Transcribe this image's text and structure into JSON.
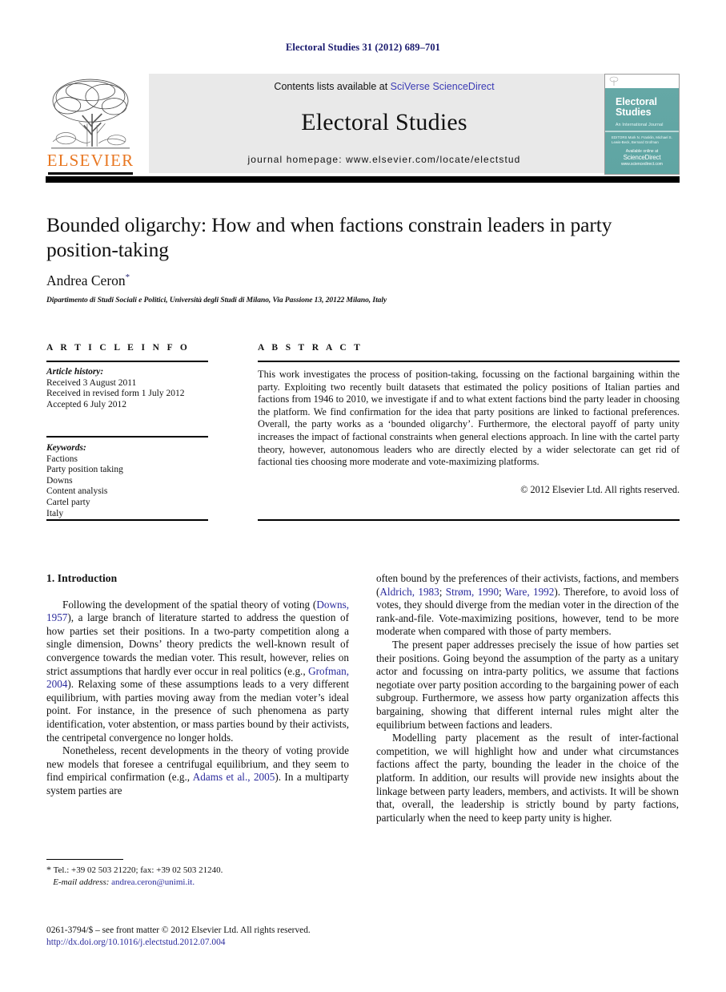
{
  "running_head": "Electoral Studies 31 (2012) 689–701",
  "header": {
    "elsevier_wordmark": "ELSEVIER",
    "contents_prefix": "Contents lists available at ",
    "contents_link": "SciVerse ScienceDirect",
    "journal_title": "Electoral Studies",
    "homepage": "journal homepage: www.elsevier.com/locate/electstud",
    "cover": {
      "title_line1": "Electoral",
      "title_line2": "Studies",
      "subtitle": "An International Journal",
      "small_text": "EDITORS  Mark N. Franklin, Michael S. Lewis-Beck, Bernard Grofman",
      "footer_label": "Available online at",
      "footer_brand": "ScienceDirect",
      "footer_url": "www.sciencedirect.com",
      "bg_color": "#5fa5a3"
    }
  },
  "article": {
    "title": "Bounded oligarchy: How and when factions constrain leaders in party position-taking",
    "author": "Andrea Ceron",
    "author_marker": "*",
    "affiliation": "Dipartimento di Studi Sociali e Politici, Università degli Studi di Milano, Via Passione 13, 20122 Milano, Italy"
  },
  "article_info": {
    "heading": "A R T I C L E   I N F O",
    "history_label": "Article history:",
    "history": [
      "Received 3 August 2011",
      "Received in revised form 1 July 2012",
      "Accepted 6 July 2012"
    ],
    "keywords_label": "Keywords:",
    "keywords": [
      "Factions",
      "Party position taking",
      "Downs",
      "Content analysis",
      "Cartel party",
      "Italy"
    ]
  },
  "abstract": {
    "heading": "A B S T R A C T",
    "text": "This work investigates the process of position-taking, focussing on the factional bargaining within the party. Exploiting two recently built datasets that estimated the policy positions of Italian parties and factions from 1946 to 2010, we investigate if and to what extent factions bind the party leader in choosing the platform. We find confirmation for the idea that party positions are linked to factional preferences. Overall, the party works as a ‘bounded oligarchy’. Furthermore, the electoral payoff of party unity increases the impact of factional constraints when general elections approach. In line with the cartel party theory, however, autonomous leaders who are directly elected by a wider selectorate can get rid of factional ties choosing more moderate and vote-maximizing platforms.",
    "copyright": "© 2012 Elsevier Ltd. All rights reserved."
  },
  "body": {
    "section_heading": "1. Introduction",
    "left_paragraphs": [
      "Following the development of the spatial theory of voting (Downs, 1957), a large branch of literature started to address the question of how parties set their positions. In a two-party competition along a single dimension, Downs’ theory predicts the well-known result of convergence towards the median voter. This result, however, relies on strict assumptions that hardly ever occur in real politics (e.g., Grofman, 2004). Relaxing some of these assumptions leads to a very different equilibrium, with parties moving away from the median voter’s ideal point. For instance, in the presence of such phenomena as party identification, voter abstention, or mass parties bound by their activists, the centripetal convergence no longer holds.",
      "Nonetheless, recent developments in the theory of voting provide new models that foresee a centrifugal equilibrium, and they seem to find empirical confirmation (e.g., Adams et al., 2005). In a multiparty system parties are"
    ],
    "right_paragraphs": [
      "often bound by the preferences of their activists, factions, and members (Aldrich, 1983; Strøm, 1990; Ware, 1992). Therefore, to avoid loss of votes, they should diverge from the median voter in the direction of the rank-and-file. Vote-maximizing positions, however, tend to be more moderate when compared with those of party members.",
      "The present paper addresses precisely the issue of how parties set their positions. Going beyond the assumption of the party as a unitary actor and focussing on intra-party politics, we assume that factions negotiate over party position according to the bargaining power of each subgroup. Furthermore, we assess how party organization affects this bargaining, showing that different internal rules might alter the equilibrium between factions and leaders.",
      "Modelling party placement as the result of inter-factional competition, we will highlight how and under what circumstances factions affect the party, bounding the leader in the choice of the platform. In addition, our results will provide new insights about the linkage between party leaders, members, and activists. It will be shown that, overall, the leadership is strictly bound by party factions, particularly when the need to keep party unity is higher."
    ]
  },
  "footnote": {
    "marker": "*",
    "contact": "Tel.: +39 02 503 21220; fax: +39 02 503 21240.",
    "email_label": "E-mail address:",
    "email": "andrea.ceron@unimi.it."
  },
  "imprint": {
    "line1": "0261-3794/$ – see front matter © 2012 Elsevier Ltd. All rights reserved.",
    "doi": "http://dx.doi.org/10.1016/j.electstud.2012.07.004"
  },
  "colors": {
    "link": "#2b2b9c",
    "running_head": "#1a1a6e",
    "elsevier_orange": "#e87722",
    "banner_bg": "#e9e9e9"
  }
}
